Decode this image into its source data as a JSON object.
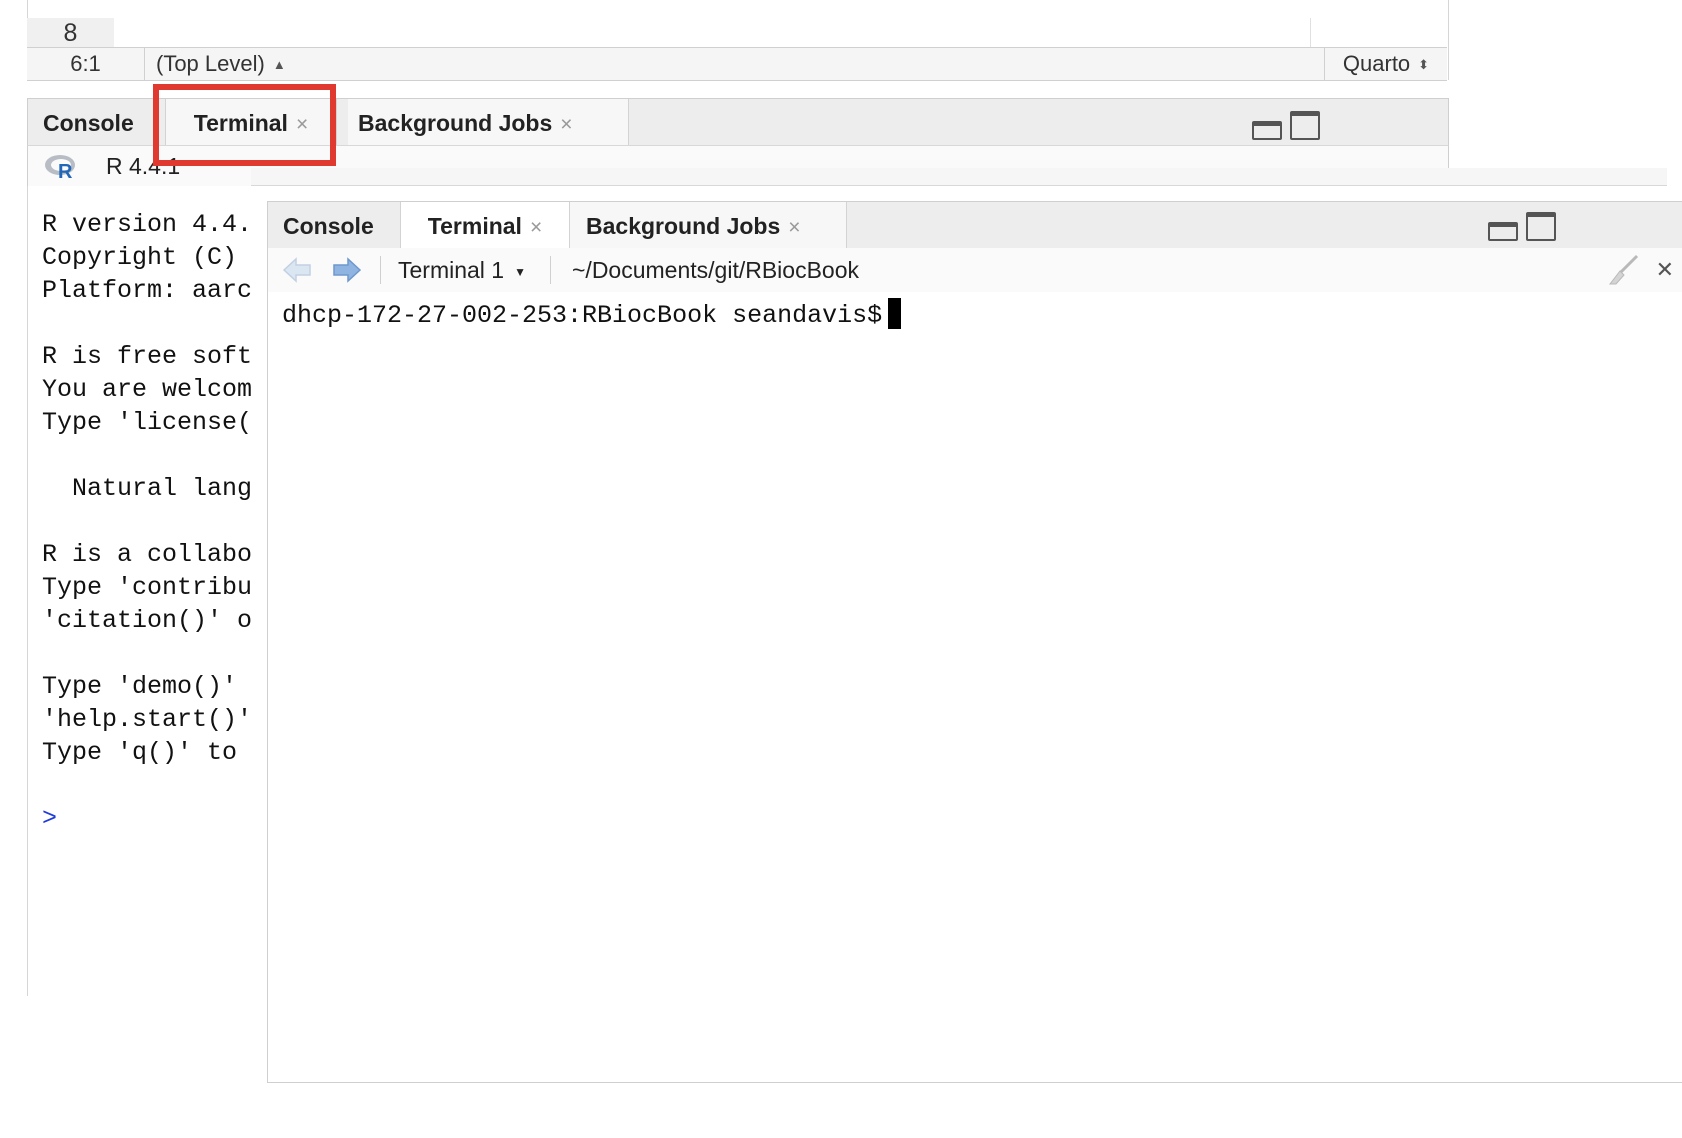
{
  "editor": {
    "line_number": "8",
    "cursor_position": "6:1",
    "scope": "(Top Level)",
    "doc_mode": "Quarto"
  },
  "tabs": {
    "console": "Console",
    "terminal": "Terminal",
    "background_jobs": "Background Jobs"
  },
  "back_console": {
    "r_version_label": "R 4.4.1",
    "lines": [
      "R version 4.4.",
      "Copyright (C)",
      "Platform: aarc",
      "",
      "R is free soft",
      "You are welcom",
      "Type 'license(",
      "",
      "  Natural lang",
      "",
      "R is a collabo",
      "Type 'contribu",
      "'citation()' o",
      "",
      "Type 'demo()'",
      "'help.start()'",
      "Type 'q()' to"
    ],
    "prompt": ">"
  },
  "terminal_pane": {
    "terminal_name": "Terminal 1",
    "working_dir": "~/Documents/git/RBiocBook",
    "prompt_text": "dhcp-172-27-002-253:RBiocBook seandavis$"
  },
  "icons": [
    "r-logo-icon",
    "minimize-icon",
    "maximize-icon",
    "back-arrow-icon",
    "forward-arrow-icon",
    "broom-icon",
    "close-icon",
    "tab-close-icon",
    "chevron-down-icon"
  ],
  "colors": {
    "highlight_box": "#e03a30",
    "prompt": "#1f3cd6"
  }
}
